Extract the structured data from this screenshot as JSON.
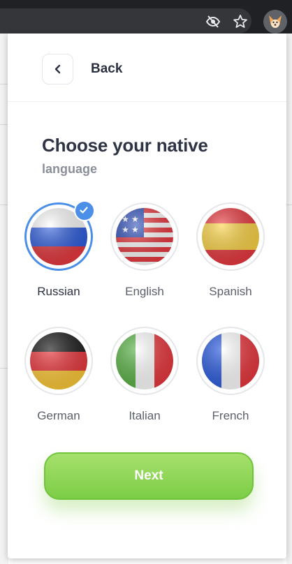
{
  "header": {
    "back_label": "Back"
  },
  "heading": {
    "title": "Choose your native",
    "subtitle": "language"
  },
  "languages": [
    {
      "label": "Russian",
      "flag": "russia-flag",
      "selected": true
    },
    {
      "label": "English",
      "flag": "usa-flag",
      "selected": false
    },
    {
      "label": "Spanish",
      "flag": "spain-flag",
      "selected": false
    },
    {
      "label": "German",
      "flag": "germany-flag",
      "selected": false
    },
    {
      "label": "Italian",
      "flag": "italy-flag",
      "selected": false
    },
    {
      "label": "French",
      "flag": "france-flag",
      "selected": false
    }
  ],
  "actions": {
    "next_label": "Next"
  },
  "colors": {
    "accent": "#4b8fe8",
    "button": "#8ed356",
    "title": "#2f3445"
  }
}
